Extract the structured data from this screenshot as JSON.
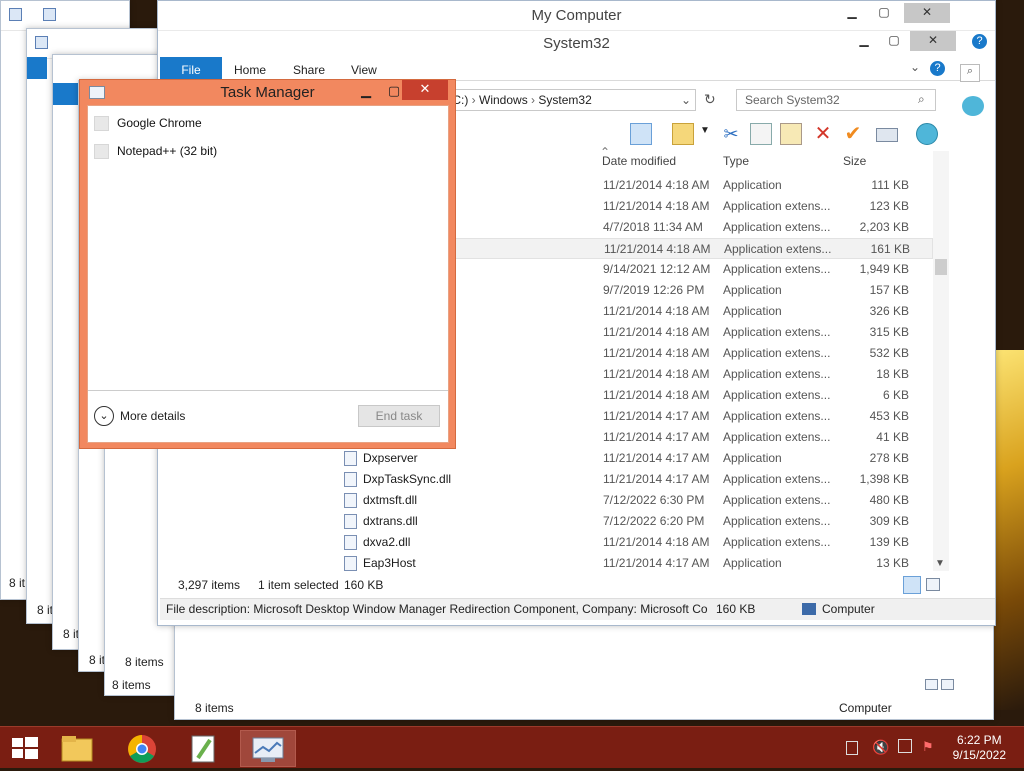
{
  "main_window": {
    "title": "My Computer",
    "subtitle": "System32",
    "tabs": [
      "File",
      "Home",
      "Share",
      "View"
    ],
    "address": {
      "segments": [
        "k (C:)",
        "Windows",
        "System32"
      ]
    },
    "search_placeholder": "Search System32",
    "columns": {
      "date": "Date modified",
      "type": "Type",
      "size": "Size"
    },
    "files": [
      {
        "name": "",
        "date": "11/21/2014 4:18 AM",
        "type": "Application",
        "size": "111 KB"
      },
      {
        "name": "",
        "date": "11/21/2014 4:18 AM",
        "type": "Application extens...",
        "size": "123 KB"
      },
      {
        "name": "",
        "date": "4/7/2018 11:34 AM",
        "type": "Application extens...",
        "size": "2,203 KB"
      },
      {
        "name": "",
        "date": "11/21/2014 4:18 AM",
        "type": "Application extens...",
        "size": "161 KB",
        "selected": true
      },
      {
        "name": "",
        "date": "9/14/2021 12:12 AM",
        "type": "Application extens...",
        "size": "1,949 KB"
      },
      {
        "name": "",
        "date": "9/7/2019 12:26 PM",
        "type": "Application",
        "size": "157 KB"
      },
      {
        "name": "",
        "date": "11/21/2014 4:18 AM",
        "type": "Application",
        "size": "326 KB"
      },
      {
        "name": "",
        "date": "11/21/2014 4:18 AM",
        "type": "Application extens...",
        "size": "315 KB"
      },
      {
        "name": "",
        "date": "11/21/2014 4:18 AM",
        "type": "Application extens...",
        "size": "532 KB"
      },
      {
        "name": "",
        "date": "11/21/2014 4:18 AM",
        "type": "Application extens...",
        "size": "18 KB"
      },
      {
        "name": "",
        "date": "11/21/2014 4:18 AM",
        "type": "Application extens...",
        "size": "6 KB"
      },
      {
        "name": "",
        "date": "11/21/2014 4:17 AM",
        "type": "Application extens...",
        "size": "453 KB"
      },
      {
        "name": "",
        "date": "11/21/2014 4:17 AM",
        "type": "Application extens...",
        "size": "41 KB"
      },
      {
        "name": "Dxpserver",
        "date": "11/21/2014 4:17 AM",
        "type": "Application",
        "size": "278 KB"
      },
      {
        "name": "DxpTaskSync.dll",
        "date": "11/21/2014 4:17 AM",
        "type": "Application extens...",
        "size": "1,398 KB"
      },
      {
        "name": "dxtmsft.dll",
        "date": "7/12/2022 6:30 PM",
        "type": "Application extens...",
        "size": "480 KB"
      },
      {
        "name": "dxtrans.dll",
        "date": "7/12/2022 6:20 PM",
        "type": "Application extens...",
        "size": "309 KB"
      },
      {
        "name": "dxva2.dll",
        "date": "11/21/2014 4:18 AM",
        "type": "Application extens...",
        "size": "139 KB"
      },
      {
        "name": "Eap3Host",
        "date": "11/21/2014 4:17 AM",
        "type": "Application",
        "size": "13 KB"
      }
    ],
    "status": {
      "count": "3,297 items",
      "selected": "1 item selected",
      "size": "160 KB"
    },
    "details": {
      "description": "File description: Microsoft Desktop Window Manager Redirection Component, Company: Microsoft Co",
      "size": "160 KB",
      "location": "Computer"
    }
  },
  "background_windows": {
    "status_8items": "8 items",
    "status_8it": "8 it",
    "computer": "Computer"
  },
  "task_manager": {
    "title": "Task Manager",
    "apps": [
      "Google Chrome",
      "Notepad++ (32 bit)"
    ],
    "more_details": "More details",
    "end_task": "End task"
  },
  "taskbar": {
    "time": "6:22 PM",
    "date": "9/15/2022"
  },
  "colors": {
    "accent": "#1979ca",
    "taskbar": "#7a1e12",
    "task_manager_frame": "#f2885f"
  }
}
